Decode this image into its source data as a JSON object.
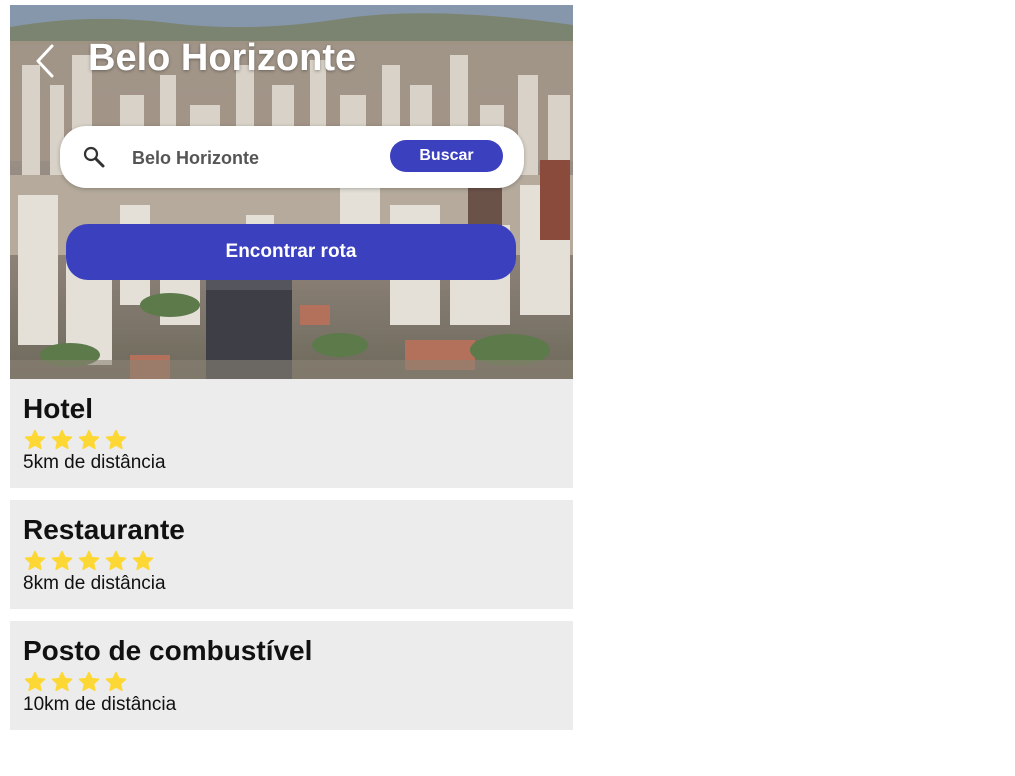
{
  "header": {
    "title": "Belo Horizonte",
    "back_icon": "chevron-left-icon"
  },
  "search": {
    "value": "Belo Horizonte",
    "icon": "search-icon",
    "button_label": "Buscar"
  },
  "route_button_label": "Encontrar rota",
  "places": [
    {
      "name": "Hotel",
      "rating": 4,
      "distance": "5km de distância"
    },
    {
      "name": "Restaurante",
      "rating": 5,
      "distance": "8km de distância"
    },
    {
      "name": "Posto de combustível",
      "rating": 4,
      "distance": "10km de distância"
    }
  ],
  "colors": {
    "accent": "#3b40bf",
    "star": "#fdd835",
    "card_bg": "#ececec"
  }
}
